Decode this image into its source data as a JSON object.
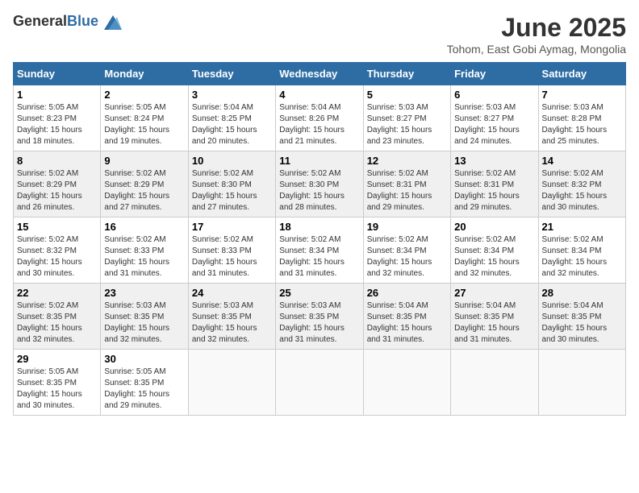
{
  "header": {
    "logo_general": "General",
    "logo_blue": "Blue",
    "month_title": "June 2025",
    "location": "Tohom, East Gobi Aymag, Mongolia"
  },
  "weekdays": [
    "Sunday",
    "Monday",
    "Tuesday",
    "Wednesday",
    "Thursday",
    "Friday",
    "Saturday"
  ],
  "weeks": [
    [
      {
        "day": "1",
        "sunrise": "5:05 AM",
        "sunset": "8:23 PM",
        "daylight": "15 hours and 18 minutes."
      },
      {
        "day": "2",
        "sunrise": "5:05 AM",
        "sunset": "8:24 PM",
        "daylight": "15 hours and 19 minutes."
      },
      {
        "day": "3",
        "sunrise": "5:04 AM",
        "sunset": "8:25 PM",
        "daylight": "15 hours and 20 minutes."
      },
      {
        "day": "4",
        "sunrise": "5:04 AM",
        "sunset": "8:26 PM",
        "daylight": "15 hours and 21 minutes."
      },
      {
        "day": "5",
        "sunrise": "5:03 AM",
        "sunset": "8:27 PM",
        "daylight": "15 hours and 23 minutes."
      },
      {
        "day": "6",
        "sunrise": "5:03 AM",
        "sunset": "8:27 PM",
        "daylight": "15 hours and 24 minutes."
      },
      {
        "day": "7",
        "sunrise": "5:03 AM",
        "sunset": "8:28 PM",
        "daylight": "15 hours and 25 minutes."
      }
    ],
    [
      {
        "day": "8",
        "sunrise": "5:02 AM",
        "sunset": "8:29 PM",
        "daylight": "15 hours and 26 minutes."
      },
      {
        "day": "9",
        "sunrise": "5:02 AM",
        "sunset": "8:29 PM",
        "daylight": "15 hours and 27 minutes."
      },
      {
        "day": "10",
        "sunrise": "5:02 AM",
        "sunset": "8:30 PM",
        "daylight": "15 hours and 27 minutes."
      },
      {
        "day": "11",
        "sunrise": "5:02 AM",
        "sunset": "8:30 PM",
        "daylight": "15 hours and 28 minutes."
      },
      {
        "day": "12",
        "sunrise": "5:02 AM",
        "sunset": "8:31 PM",
        "daylight": "15 hours and 29 minutes."
      },
      {
        "day": "13",
        "sunrise": "5:02 AM",
        "sunset": "8:31 PM",
        "daylight": "15 hours and 29 minutes."
      },
      {
        "day": "14",
        "sunrise": "5:02 AM",
        "sunset": "8:32 PM",
        "daylight": "15 hours and 30 minutes."
      }
    ],
    [
      {
        "day": "15",
        "sunrise": "5:02 AM",
        "sunset": "8:32 PM",
        "daylight": "15 hours and 30 minutes."
      },
      {
        "day": "16",
        "sunrise": "5:02 AM",
        "sunset": "8:33 PM",
        "daylight": "15 hours and 31 minutes."
      },
      {
        "day": "17",
        "sunrise": "5:02 AM",
        "sunset": "8:33 PM",
        "daylight": "15 hours and 31 minutes."
      },
      {
        "day": "18",
        "sunrise": "5:02 AM",
        "sunset": "8:34 PM",
        "daylight": "15 hours and 31 minutes."
      },
      {
        "day": "19",
        "sunrise": "5:02 AM",
        "sunset": "8:34 PM",
        "daylight": "15 hours and 32 minutes."
      },
      {
        "day": "20",
        "sunrise": "5:02 AM",
        "sunset": "8:34 PM",
        "daylight": "15 hours and 32 minutes."
      },
      {
        "day": "21",
        "sunrise": "5:02 AM",
        "sunset": "8:34 PM",
        "daylight": "15 hours and 32 minutes."
      }
    ],
    [
      {
        "day": "22",
        "sunrise": "5:02 AM",
        "sunset": "8:35 PM",
        "daylight": "15 hours and 32 minutes."
      },
      {
        "day": "23",
        "sunrise": "5:03 AM",
        "sunset": "8:35 PM",
        "daylight": "15 hours and 32 minutes."
      },
      {
        "day": "24",
        "sunrise": "5:03 AM",
        "sunset": "8:35 PM",
        "daylight": "15 hours and 32 minutes."
      },
      {
        "day": "25",
        "sunrise": "5:03 AM",
        "sunset": "8:35 PM",
        "daylight": "15 hours and 31 minutes."
      },
      {
        "day": "26",
        "sunrise": "5:04 AM",
        "sunset": "8:35 PM",
        "daylight": "15 hours and 31 minutes."
      },
      {
        "day": "27",
        "sunrise": "5:04 AM",
        "sunset": "8:35 PM",
        "daylight": "15 hours and 31 minutes."
      },
      {
        "day": "28",
        "sunrise": "5:04 AM",
        "sunset": "8:35 PM",
        "daylight": "15 hours and 30 minutes."
      }
    ],
    [
      {
        "day": "29",
        "sunrise": "5:05 AM",
        "sunset": "8:35 PM",
        "daylight": "15 hours and 30 minutes."
      },
      {
        "day": "30",
        "sunrise": "5:05 AM",
        "sunset": "8:35 PM",
        "daylight": "15 hours and 29 minutes."
      },
      null,
      null,
      null,
      null,
      null
    ]
  ]
}
